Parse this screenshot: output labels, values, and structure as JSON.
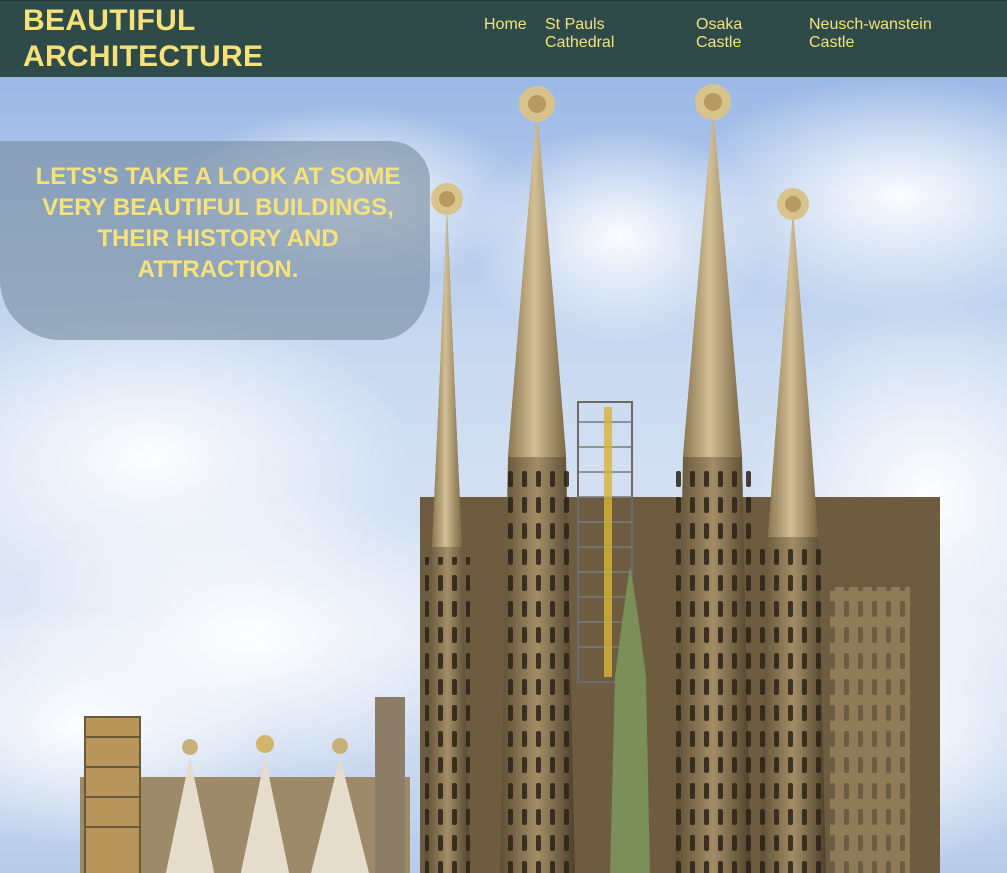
{
  "header": {
    "brand_line1": "BEAUTIFUL",
    "brand_line2": "ARCHITECTURE",
    "nav": [
      {
        "line1": "Home",
        "line2": ""
      },
      {
        "line1": "St Pauls",
        "line2": "Cathedral"
      },
      {
        "line1": "Osaka",
        "line2": "Castle"
      },
      {
        "line1": "Neusch-wanstein",
        "line2": "Castle"
      }
    ]
  },
  "hero": {
    "intro_line1": "LETS'S TAKE A LOOK AT SOME",
    "intro_line2": "VERY BEAUTIFUL BUILDINGS,",
    "intro_line3": "THEIR HISTORY AND",
    "intro_line4": "ATTRACTION."
  },
  "colors": {
    "header_bg": "#2e4b4a",
    "accent_yellow": "#f7e27a",
    "stone": "#b8a27a",
    "sky": "#9bb8e6"
  }
}
